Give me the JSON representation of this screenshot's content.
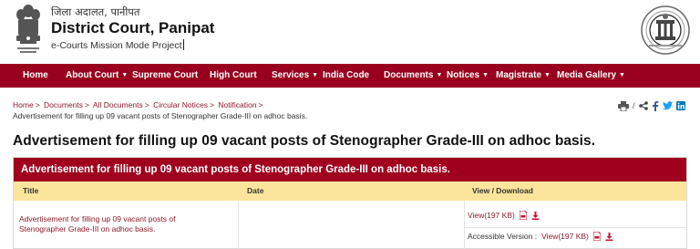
{
  "header": {
    "hindi_title": "जिला अदालत, पानीपत",
    "court_name": "District Court, Panipat",
    "mission": "e-Courts Mission Mode Project"
  },
  "nav": {
    "items": [
      {
        "label": "Home",
        "dropdown": false
      },
      {
        "label": "About Court",
        "dropdown": true
      },
      {
        "label": "Supreme Court",
        "dropdown": false
      },
      {
        "label": "High Court",
        "dropdown": false
      },
      {
        "label": "Services",
        "dropdown": true
      },
      {
        "label": "India Code",
        "dropdown": false
      },
      {
        "label": "Documents",
        "dropdown": true
      },
      {
        "label": "Notices",
        "dropdown": true
      },
      {
        "label": "Magistrate",
        "dropdown": true
      },
      {
        "label": "Media Gallery",
        "dropdown": true
      }
    ],
    "dropdown_arrow": "▼"
  },
  "breadcrumb": {
    "items": [
      "Home",
      "Documents",
      "All Documents",
      "Circular Notices",
      "Notification"
    ],
    "separator": ">",
    "current": "Advertisement for filling up 09 vacant posts of Stenographer Grade-III on adhoc basis."
  },
  "share": {
    "icons": [
      "print-icon",
      "share-icon",
      "facebook-icon",
      "twitter-icon",
      "linkedin-icon"
    ],
    "divider": "/"
  },
  "page_title": "Advertisement for filling up 09 vacant posts of Stenographer Grade-III on adhoc basis.",
  "table": {
    "caption": "Advertisement for filling up 09 vacant posts of Stenographer Grade-III on adhoc basis.",
    "columns": [
      "Title",
      "Date",
      "View / Download"
    ],
    "rows": [
      {
        "title": "Advertisement for filling up 09 vacant posts of Stenographer Grade-III on adhoc basis.",
        "date": "",
        "view_label": "View(197 KB)",
        "accessible_prefix": "Accessible Version : ",
        "accessible_label": "View(197 KB)"
      }
    ]
  },
  "colors": {
    "nav_bg": "#99001d",
    "caption_bg": "#a0001e",
    "thead_bg": "#fbe49c",
    "link": "#8e1a2a"
  }
}
